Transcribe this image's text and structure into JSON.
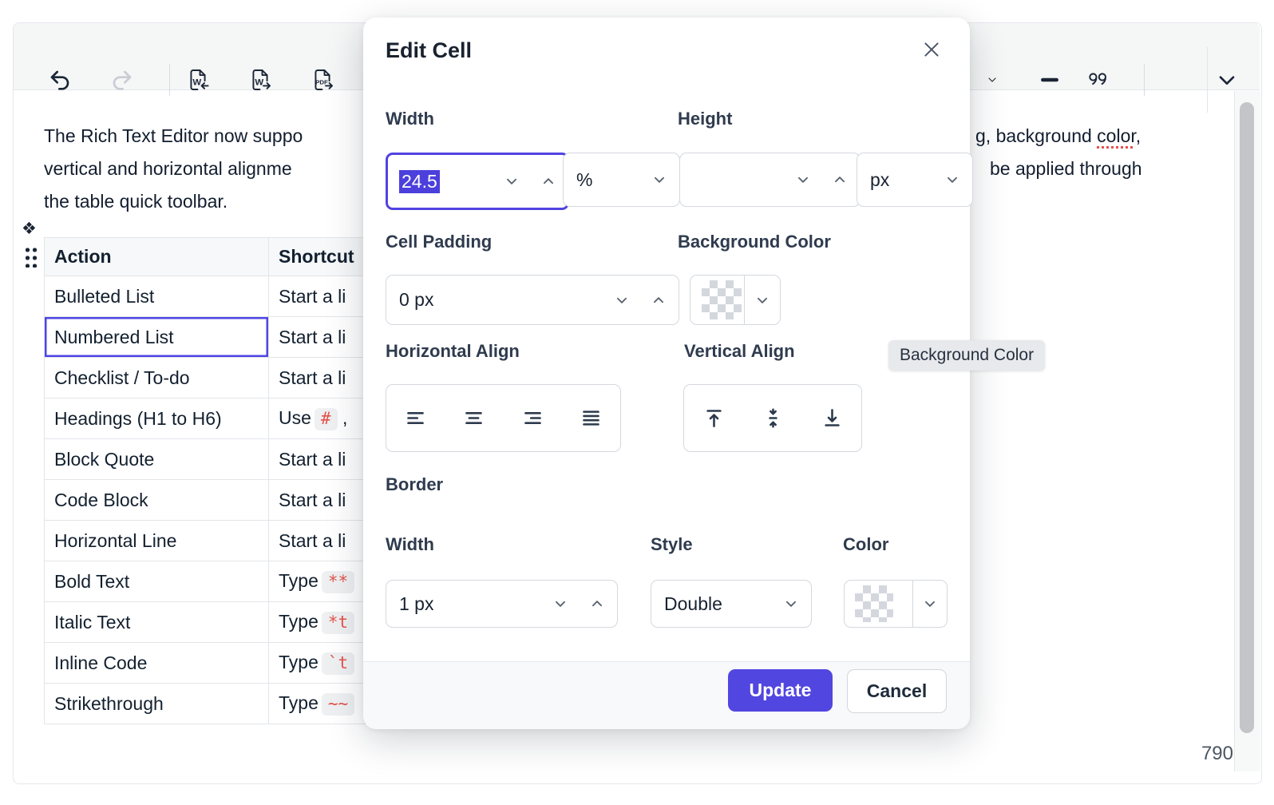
{
  "toolbar": {
    "left_icons": [
      "undo",
      "redo",
      "import-word",
      "export-word",
      "export-pdf"
    ],
    "right_icons": [
      "dropdown-partial",
      "horizontal-line",
      "blockquote",
      "expand-toolbar"
    ]
  },
  "document": {
    "paragraph": {
      "line1_left": "The Rich Text Editor now suppo",
      "line1_right_pre": "g, background ",
      "line1_right_spell": "color",
      "line1_right_post": ",",
      "line2_left": "vertical and horizontal alignme",
      "line2_right": "be applied through",
      "line3": "the table quick toolbar."
    },
    "table": {
      "headers": [
        "Action",
        "Shortcut"
      ],
      "selected_cell": "Numbered List",
      "rows": [
        {
          "action": "Bulleted List",
          "prefix": "Start a li",
          "code": "",
          "suffix": ""
        },
        {
          "action": "Numbered List",
          "prefix": "Start a li",
          "code": "",
          "suffix": ""
        },
        {
          "action": "Checklist / To-do",
          "prefix": "Start a li",
          "code": "",
          "suffix": ""
        },
        {
          "action": "Headings (H1 to H6)",
          "prefix": "Use",
          "code": "#",
          "suffix": " ,"
        },
        {
          "action": "Block Quote",
          "prefix": "Start a li",
          "code": "",
          "suffix": ""
        },
        {
          "action": "Code Block",
          "prefix": "Start a li",
          "code": "",
          "suffix": ""
        },
        {
          "action": "Horizontal Line",
          "prefix": "Start a li",
          "code": "",
          "suffix": ""
        },
        {
          "action": "Bold Text",
          "prefix": "Type",
          "code": "**",
          "suffix": ""
        },
        {
          "action": "Italic Text",
          "prefix": "Type",
          "code": "*t",
          "suffix": ""
        },
        {
          "action": "Inline Code",
          "prefix": "Type",
          "code": "`t",
          "suffix": ""
        },
        {
          "action": "Strikethrough",
          "prefix": "Type",
          "code": "~~",
          "suffix": ""
        }
      ]
    },
    "word_count": "790"
  },
  "dialog": {
    "title": "Edit Cell",
    "width_label": "Width",
    "width_value": "24.5",
    "width_unit": "%",
    "height_label": "Height",
    "height_value": "",
    "height_unit": "px",
    "cell_padding_label": "Cell Padding",
    "cell_padding_value": "0 px",
    "background_color_label": "Background Color",
    "background_color_value": "transparent",
    "horizontal_align_label": "Horizontal Align",
    "horizontal_align_options": [
      "left",
      "center",
      "right",
      "justify"
    ],
    "vertical_align_label": "Vertical Align",
    "vertical_align_options": [
      "top",
      "middle",
      "bottom"
    ],
    "tooltip": "Background Color",
    "border_heading": "Border",
    "border_width_label": "Width",
    "border_width_value": "1 px",
    "border_style_label": "Style",
    "border_style_value": "Double",
    "border_color_label": "Color",
    "border_color_value": "transparent",
    "update_label": "Update",
    "cancel_label": "Cancel"
  },
  "colors": {
    "accent": "#5246e0",
    "selection": "#4c40dc",
    "focus_border": "#5143e1",
    "selected_cell_border": "#4f46e5",
    "code_red": "#e5534b",
    "spellcheck_red": "#e0524e",
    "tooltip_bg": "#e7e9ec",
    "toolbar_bg": "#f5f6f6"
  }
}
